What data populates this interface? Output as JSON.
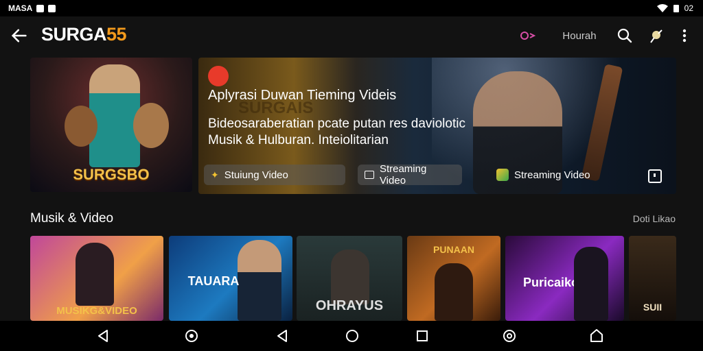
{
  "status_bar": {
    "left_text": "MASA",
    "time": "02"
  },
  "app": {
    "title_prefix": "SURGA",
    "title_number": "55",
    "action_text": "Hourah",
    "accent": "#f39a1c"
  },
  "hero": {
    "left_poster_caption": "SURGSBO",
    "brand_small": "SURGAIS",
    "headline": "Aplyrasi Duwan Tieming Videis",
    "subline_1": "Bideosaraberatian pcate putan res daviolotic",
    "subline_2": "Musik & Hulburan. Inteiolitarian",
    "chips": [
      {
        "label": "Stuiung Video",
        "icon": "sparkle-icon"
      },
      {
        "label": "Streaming Video",
        "icon": "image-icon"
      },
      {
        "label": "Streaming Video",
        "icon": "app-icon"
      }
    ]
  },
  "section": {
    "title": "Musik & Video",
    "more_label": "Doti Likao",
    "cards": [
      {
        "caption": "MUSIKG&VIDEO"
      },
      {
        "caption": "TAUARA"
      },
      {
        "caption": "OHRAYUS"
      },
      {
        "caption": "PUNAAN"
      },
      {
        "caption": "Puricaiko"
      },
      {
        "caption": "SUII"
      }
    ]
  }
}
